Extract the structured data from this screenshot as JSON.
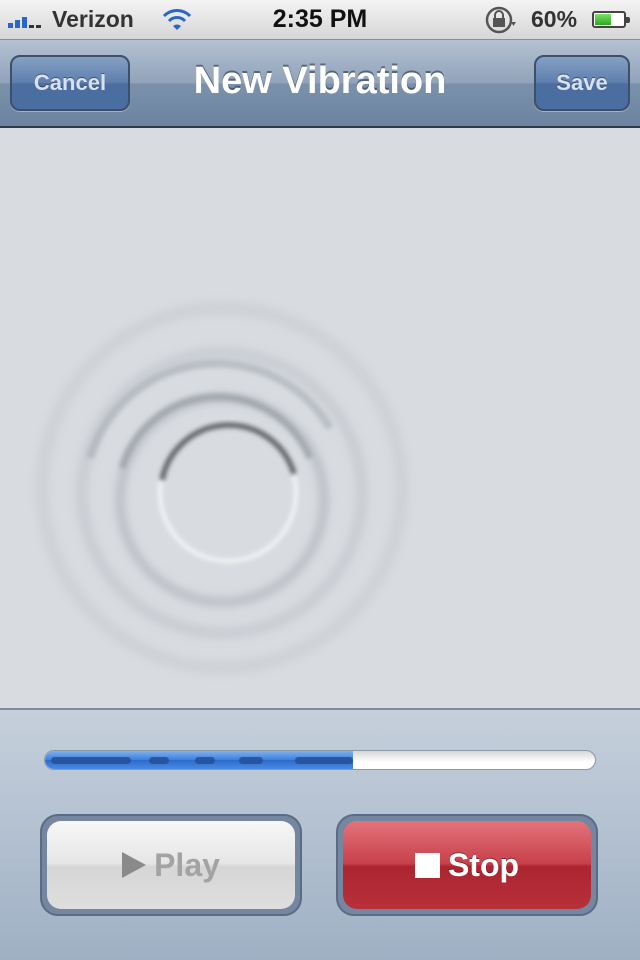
{
  "status_bar": {
    "carrier": "Verizon",
    "time": "2:35 PM",
    "battery_percent": "60%",
    "battery_level": 0.6,
    "icons": [
      "signal-icon",
      "wifi-icon",
      "rotation-lock-icon",
      "battery-icon"
    ]
  },
  "nav": {
    "title": "New Vibration",
    "cancel_label": "Cancel",
    "save_label": "Save"
  },
  "recording": {
    "progress": 0.56,
    "pulses_shown": 5
  },
  "controls": {
    "play_label": "Play",
    "stop_label": "Stop",
    "play_enabled": false,
    "play_icon": "play-icon",
    "stop_icon": "stop-icon"
  },
  "colors": {
    "nav_bar": "#7b91ab",
    "progress_blue": "#3c7fdc",
    "stop_red": "#c8414b",
    "canvas_bg": "#d8dbdf"
  }
}
